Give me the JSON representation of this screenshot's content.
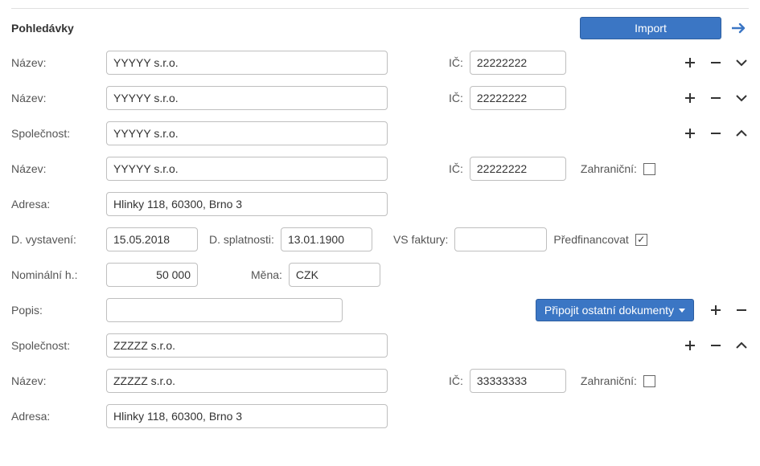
{
  "header": {
    "title": "Pohledávky",
    "import_label": "Import"
  },
  "rows": [
    {
      "nazev_label": "Název:",
      "nazev_value": "YYYYY s.r.o.",
      "ic_label": "IČ:",
      "ic_value": "22222222"
    },
    {
      "nazev_label": "Název:",
      "nazev_value": "YYYYY s.r.o.",
      "ic_label": "IČ:",
      "ic_value": "22222222"
    }
  ],
  "company1": {
    "spolecnost_label": "Společnost:",
    "spolecnost_value": "YYYYY s.r.o.",
    "nazev_label": "Název:",
    "nazev_value": "YYYYY s.r.o.",
    "ic_label": "IČ:",
    "ic_value": "22222222",
    "zahranicni_label": "Zahraniční:",
    "zahranicni_checked": false,
    "adresa_label": "Adresa:",
    "adresa_value": "Hlinky 118, 60300, Brno 3",
    "d_vystaveni_label": "D. vystavení:",
    "d_vystaveni_value": "15.05.2018",
    "d_splatnosti_label": "D. splatnosti:",
    "d_splatnosti_value": "13.01.1900",
    "vs_label": "VS faktury:",
    "vs_value": "",
    "predfin_label": "Předfinancovat",
    "predfin_checked": true,
    "nominal_label": "Nominální h.:",
    "nominal_value": "50 000",
    "mena_label": "Měna:",
    "mena_value": "CZK",
    "popis_label": "Popis:",
    "popis_value": "",
    "attach_label": "Připojit ostatní dokumenty"
  },
  "company2": {
    "spolecnost_label": "Společnost:",
    "spolecnost_value": "ZZZZZ s.r.o.",
    "nazev_label": "Název:",
    "nazev_value": "ZZZZZ s.r.o.",
    "ic_label": "IČ:",
    "ic_value": "33333333",
    "zahranicni_label": "Zahraniční:",
    "zahranicni_checked": false,
    "adresa_label": "Adresa:",
    "adresa_value": "Hlinky 118, 60300, Brno 3"
  }
}
